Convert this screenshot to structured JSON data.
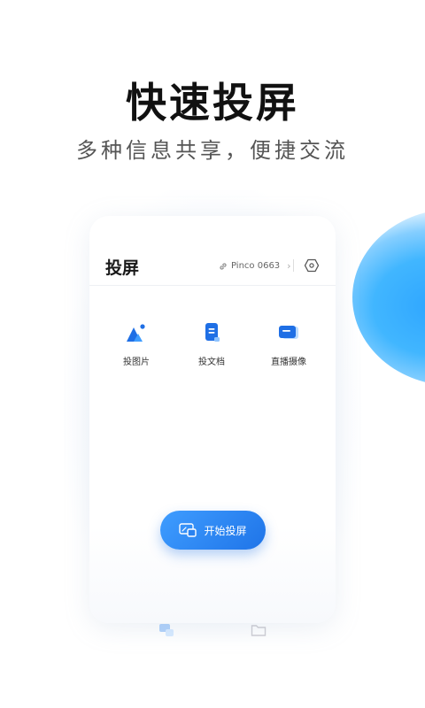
{
  "hero": {
    "title": "快速投屏",
    "subtitle": "多种信息共享，便捷交流"
  },
  "app": {
    "title": "投屏",
    "device_name": "Pinco 0663"
  },
  "functions": [
    {
      "label": "投图片",
      "icon": "image-icon"
    },
    {
      "label": "投文档",
      "icon": "document-icon"
    },
    {
      "label": "直播摄像",
      "icon": "camera-icon"
    }
  ],
  "start_button": {
    "label": "开始投屏",
    "icon": "screen-cast-icon"
  },
  "colors": {
    "accent": "#2a82f0",
    "accent_light": "#3f9dff",
    "blob": "#2fa6ff"
  }
}
